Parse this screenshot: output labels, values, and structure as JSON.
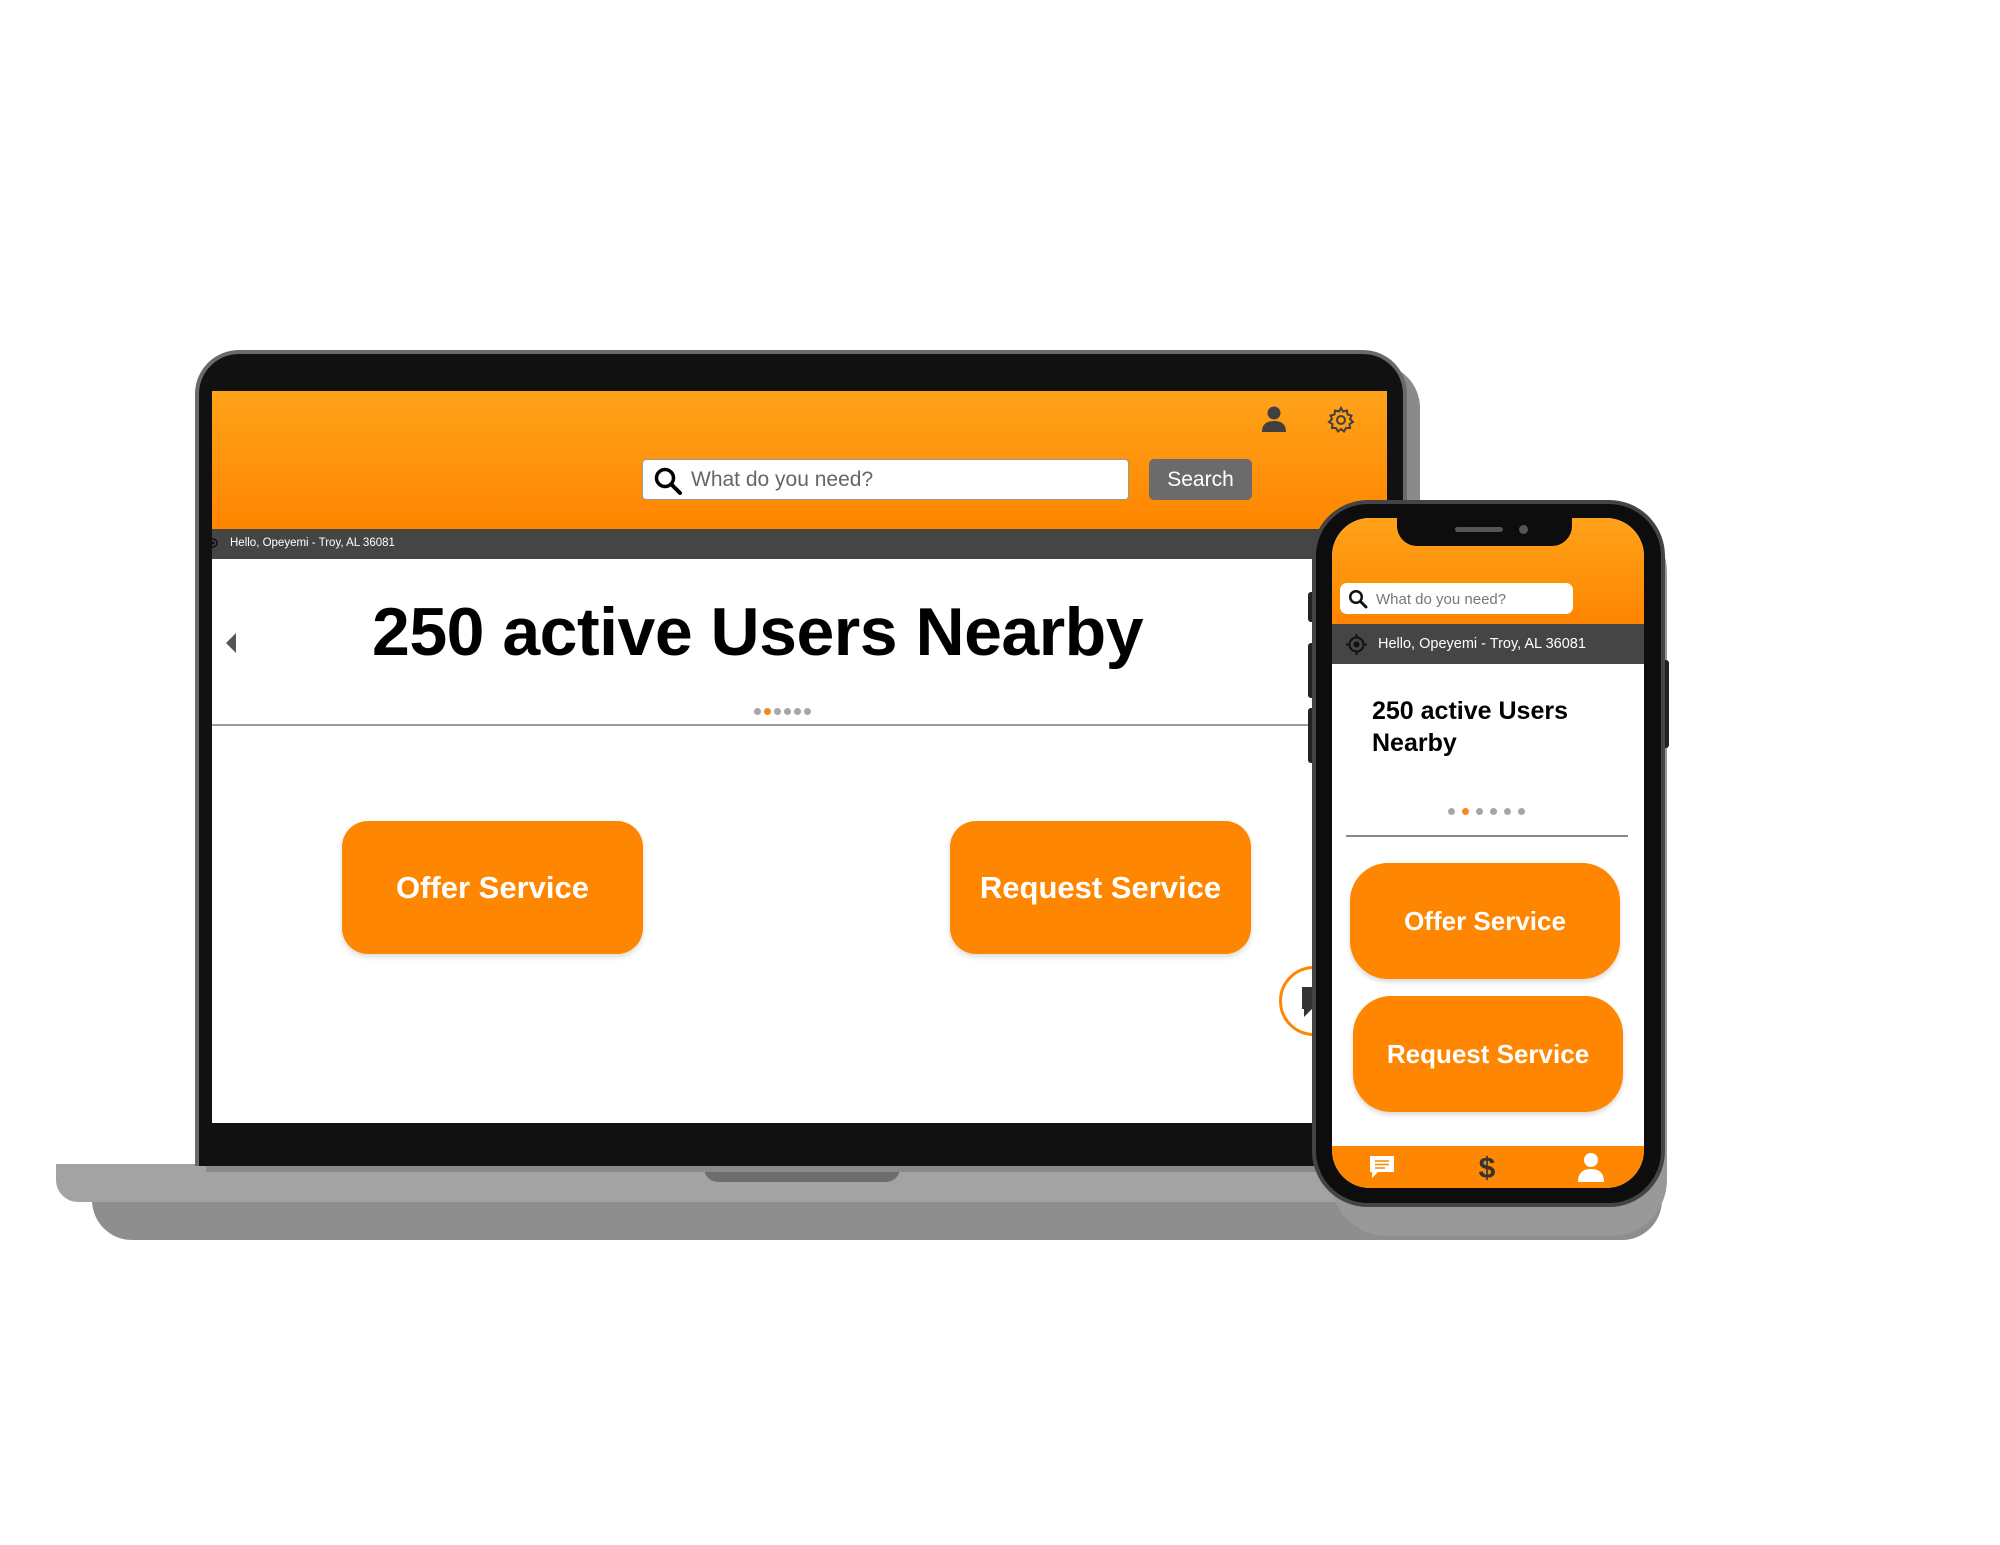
{
  "desktop": {
    "search": {
      "placeholder": "What do you need?",
      "button_label": "Search"
    },
    "location_bar": {
      "text": "Hello, Opeyemi - Troy, AL 36081"
    },
    "hero": {
      "headline": "250 active Users Nearby",
      "carousel_dots": 6,
      "active_dot": 1
    },
    "actions": {
      "offer_label": "Offer Service",
      "request_label": "Request Service"
    },
    "icons": [
      "user-icon",
      "gear-icon",
      "search-icon",
      "location-icon",
      "chevron-left-icon",
      "chat-icon"
    ]
  },
  "mobile": {
    "search": {
      "placeholder": "What do you need?"
    },
    "location_bar": {
      "text": "Hello, Opeyemi - Troy, AL 36081"
    },
    "hero": {
      "headline": "250 active Users Nearby",
      "carousel_dots": 6,
      "active_dot": 1
    },
    "actions": {
      "offer_label": "Offer Service",
      "request_label": "Request Service"
    },
    "tab_bar": [
      "chat-icon",
      "dollar-icon",
      "profile-icon"
    ]
  },
  "colors": {
    "brand_orange": "#ff8600",
    "header_top": "#ffa31a",
    "location_bar": "#454545",
    "search_button": "#6b6b6b",
    "active_dot": "#f38a1b",
    "inactive_dot": "#a6a6a6"
  }
}
